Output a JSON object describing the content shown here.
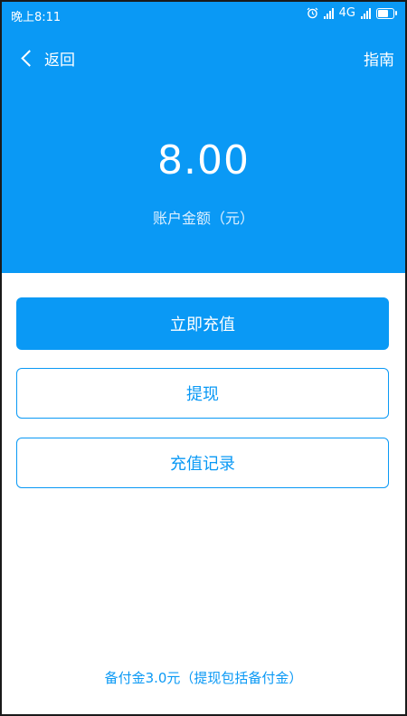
{
  "status_bar": {
    "time": "晚上8:11",
    "network": "4G"
  },
  "nav": {
    "back_label": "返回",
    "guide_label": "指南"
  },
  "account": {
    "amount": "8.00",
    "label": "账户金额（元）"
  },
  "buttons": {
    "recharge": "立即充值",
    "withdraw": "提现",
    "records": "充值记录"
  },
  "footer": {
    "note": "备付金3.0元（提现包括备付金）"
  },
  "colors": {
    "brand_blue": "#0a99f5",
    "background": "#ffffff"
  },
  "icons": [
    "back-chevron-icon",
    "alarm-icon",
    "signal-icon",
    "battery-charging-icon"
  ]
}
